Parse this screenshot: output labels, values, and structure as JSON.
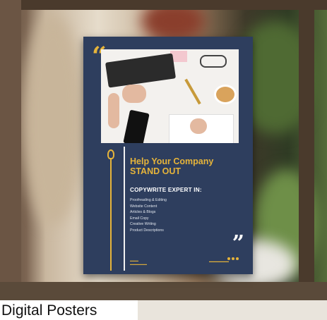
{
  "poster": {
    "quote_open": "“",
    "quote_close": "”",
    "headline_line1": "Help Your Company",
    "headline_line2": "STAND OUT",
    "subheading": "COPYWRITE EXPERT IN:",
    "services": [
      "Proofreading & Editing",
      "Website Content",
      "Articles & Blogs",
      "Email Copy",
      "Creative Writing",
      "Product Descriptions"
    ],
    "accent_color": "#e6b43a",
    "background_color": "#2e3e5e"
  },
  "caption": {
    "text": "Digital Posters"
  }
}
